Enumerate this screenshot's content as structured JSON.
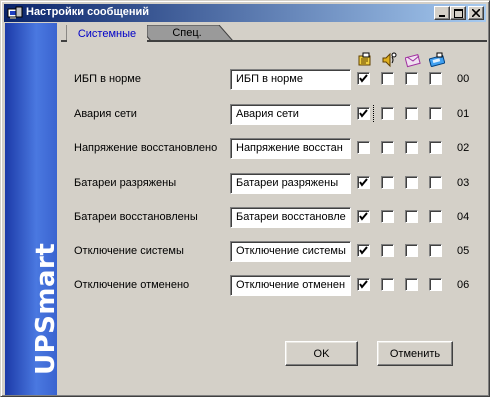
{
  "window": {
    "title": "Настройки сообщений",
    "brand": "UPSmart"
  },
  "tabs": [
    {
      "label": "Системные",
      "active": true
    },
    {
      "label": "Спец.",
      "active": false
    }
  ],
  "columns": [
    {
      "icon": "message-icon",
      "color": "#e8c020"
    },
    {
      "icon": "sound-icon",
      "color": "#d0a020"
    },
    {
      "icon": "email-icon",
      "color": "#c050c0"
    },
    {
      "icon": "pager-icon",
      "color": "#3090e0"
    }
  ],
  "rows": [
    {
      "label": "ИБП в норме",
      "value": "ИБП в норме",
      "code": "00",
      "checks": [
        true,
        false,
        false,
        false
      ]
    },
    {
      "label": "Авария сети",
      "value": "Авария сети",
      "code": "01",
      "checks": [
        true,
        false,
        false,
        false
      ]
    },
    {
      "label": "Напряжение восстановлено",
      "value": "Напряжение восстан",
      "code": "02",
      "checks": [
        false,
        false,
        false,
        false
      ]
    },
    {
      "label": "Батареи разряжены",
      "value": "Батареи разряжены",
      "code": "03",
      "checks": [
        true,
        false,
        false,
        false
      ]
    },
    {
      "label": "Батареи восстановлены",
      "value": "Батареи восстановле",
      "code": "04",
      "checks": [
        true,
        false,
        false,
        false
      ]
    },
    {
      "label": "Отключение системы",
      "value": "Отключение системы",
      "code": "05",
      "checks": [
        true,
        false,
        false,
        false
      ]
    },
    {
      "label": "Отключение отменено",
      "value": "Отключение отменен",
      "code": "06",
      "checks": [
        true,
        false,
        false,
        false
      ]
    }
  ],
  "buttons": {
    "ok": "OK",
    "cancel": "Отменить"
  }
}
